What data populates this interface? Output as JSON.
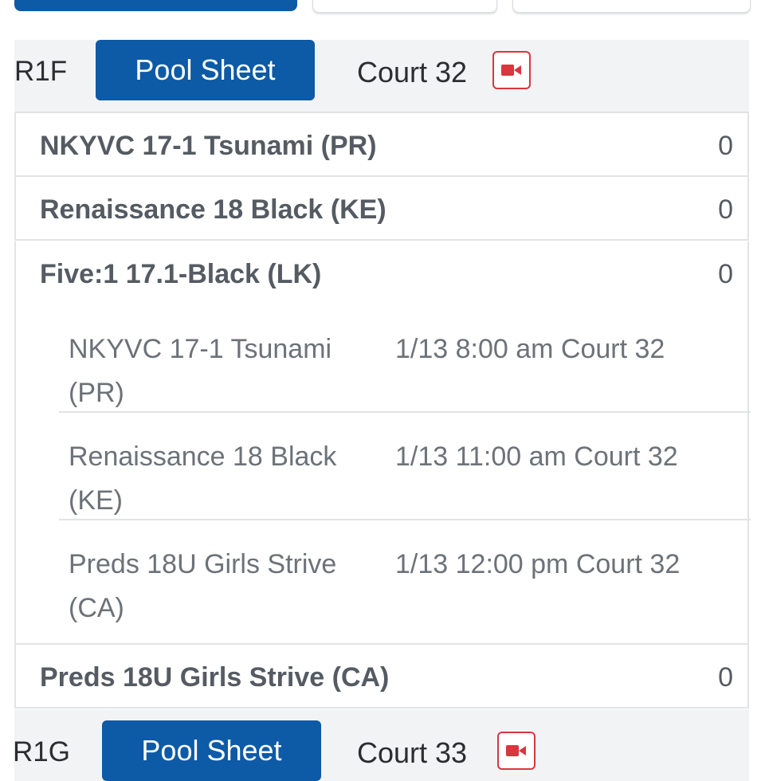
{
  "pools": [
    {
      "round_label": "R1F",
      "pool_sheet_label": "Pool Sheet",
      "court": "Court 32",
      "icon": "video-camera-icon",
      "teams": [
        {
          "name": "NKYVC 17-1 Tsunami (PR)",
          "score": "0"
        },
        {
          "name": "Renaissance 18 Black (KE)",
          "score": "0"
        },
        {
          "name": "Five:1 17.1-Black (LK)",
          "score": "0"
        },
        {
          "name": "Preds 18U Girls Strive (CA)",
          "score": "0"
        }
      ],
      "expanded_matches": [
        {
          "opponent": "NKYVC 17-1 Tsunami (PR)",
          "when": "1/13 8:00 am Court 32"
        },
        {
          "opponent": "Renaissance 18 Black (KE)",
          "when": "1/13 11:00 am Court 32"
        },
        {
          "opponent": "Preds 18U Girls Strive (CA)",
          "when": "1/13 12:00 pm Court 32"
        }
      ]
    },
    {
      "round_label": "R1G",
      "pool_sheet_label": "Pool Sheet",
      "court": "Court 33",
      "icon": "video-camera-icon"
    }
  ],
  "colors": {
    "primary": "#0d5aa7",
    "header_bg": "#f2f3f4",
    "video_red": "#d9363e",
    "text_dark": "#2a2d31",
    "text_gray": "#555b62"
  }
}
